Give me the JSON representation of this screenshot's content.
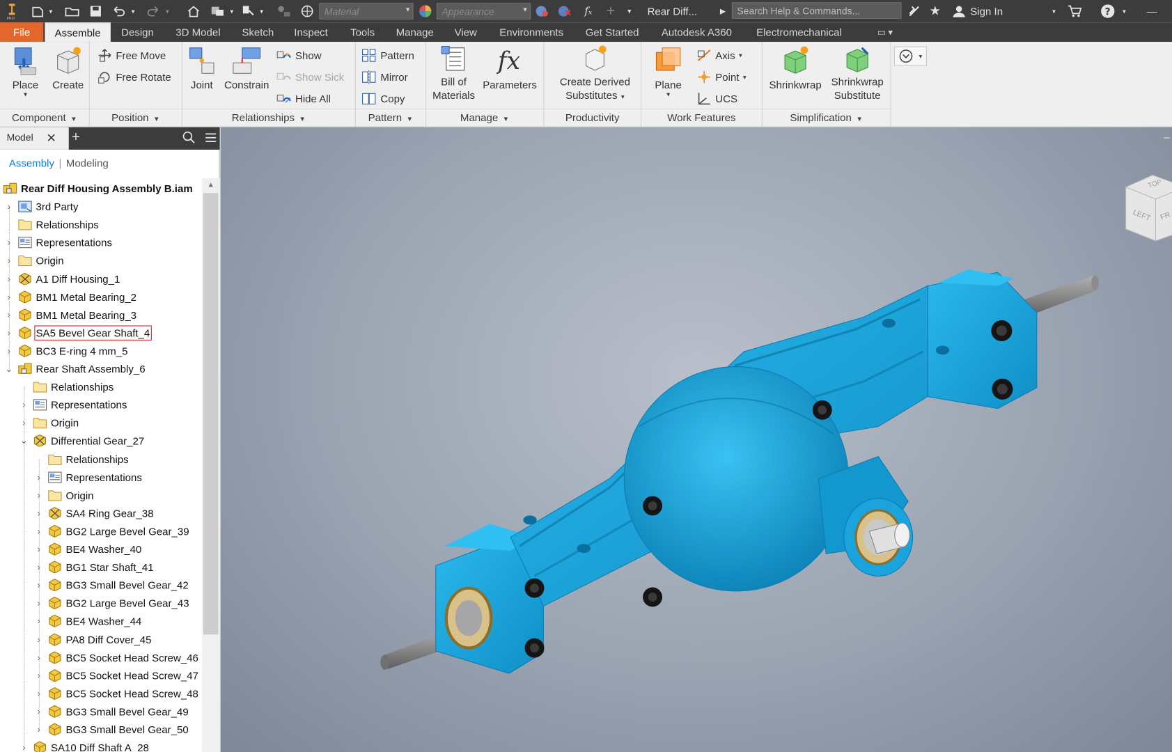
{
  "app": {
    "document_title": "Rear Diff...",
    "search_placeholder": "Search Help & Commands...",
    "sign_in": "Sign In",
    "material_placeholder": "Material",
    "appearance_placeholder": "Appearance"
  },
  "tabs": [
    {
      "label": "File"
    },
    {
      "label": "Assemble"
    },
    {
      "label": "Design"
    },
    {
      "label": "3D Model"
    },
    {
      "label": "Sketch"
    },
    {
      "label": "Inspect"
    },
    {
      "label": "Tools"
    },
    {
      "label": "Manage"
    },
    {
      "label": "View"
    },
    {
      "label": "Environments"
    },
    {
      "label": "Get Started"
    },
    {
      "label": "Autodesk A360"
    },
    {
      "label": "Electromechanical"
    }
  ],
  "ribbon": {
    "component": {
      "title": "Component",
      "place": "Place",
      "create": "Create"
    },
    "position": {
      "title": "Position",
      "free_move": "Free Move",
      "free_rotate": "Free Rotate"
    },
    "relationships": {
      "title": "Relationships",
      "joint": "Joint",
      "constrain": "Constrain",
      "show": "Show",
      "show_sick": "Show Sick",
      "hide_all": "Hide All"
    },
    "pattern": {
      "title": "Pattern",
      "pattern": "Pattern",
      "mirror": "Mirror",
      "copy": "Copy"
    },
    "manage": {
      "title": "Manage",
      "bom_line1": "Bill of",
      "bom_line2": "Materials",
      "parameters": "Parameters"
    },
    "productivity": {
      "title": "Productivity",
      "cds_line1": "Create Derived",
      "cds_line2": "Substitutes"
    },
    "work_features": {
      "title": "Work Features",
      "plane": "Plane",
      "axis": "Axis",
      "point": "Point",
      "ucs": "UCS"
    },
    "simplification": {
      "title": "Simplification",
      "shrinkwrap": "Shrinkwrap",
      "sws_line1": "Shrinkwrap",
      "sws_line2": "Substitute"
    }
  },
  "browser": {
    "tab_label": "Model",
    "subtab_assembly": "Assembly",
    "subtab_modeling": "Modeling",
    "items": [
      {
        "label": "Rear Diff Housing Assembly B.iam",
        "level": 0,
        "icon": "assembly-icon",
        "exp": ""
      },
      {
        "label": "3rd Party",
        "level": 0,
        "icon": "third-party-icon",
        "exp": ">"
      },
      {
        "label": "Relationships",
        "level": 0,
        "icon": "folder-icon",
        "exp": ""
      },
      {
        "label": "Representations",
        "level": 0,
        "icon": "representations-icon",
        "exp": ">"
      },
      {
        "label": "Origin",
        "level": 0,
        "icon": "folder-icon",
        "exp": ">"
      },
      {
        "label": "A1 Diff Housing_1",
        "level": 0,
        "icon": "adaptive-part-icon",
        "exp": ">"
      },
      {
        "label": "BM1 Metal Bearing_2",
        "level": 0,
        "icon": "part-icon",
        "exp": ">"
      },
      {
        "label": "BM1 Metal Bearing_3",
        "level": 0,
        "icon": "part-icon",
        "exp": ">"
      },
      {
        "label": "SA5 Bevel Gear Shaft_4",
        "level": 0,
        "icon": "part-icon",
        "exp": ">",
        "highlight": true
      },
      {
        "label": "BC3 E-ring 4 mm_5",
        "level": 0,
        "icon": "part-icon",
        "exp": ">"
      },
      {
        "label": "Rear Shaft Assembly_6",
        "level": 0,
        "icon": "subassembly-icon",
        "exp": "v"
      },
      {
        "label": "Relationships",
        "level": 1,
        "icon": "folder-icon",
        "exp": ""
      },
      {
        "label": "Representations",
        "level": 1,
        "icon": "representations-icon",
        "exp": ">"
      },
      {
        "label": "Origin",
        "level": 1,
        "icon": "folder-icon",
        "exp": ">"
      },
      {
        "label": "Differential Gear_27",
        "level": 1,
        "icon": "adaptive-part-icon",
        "exp": "v"
      },
      {
        "label": "Relationships",
        "level": 2,
        "icon": "folder-icon",
        "exp": ""
      },
      {
        "label": "Representations",
        "level": 2,
        "icon": "representations-icon",
        "exp": ">"
      },
      {
        "label": "Origin",
        "level": 2,
        "icon": "folder-icon",
        "exp": ">"
      },
      {
        "label": "SA4 Ring Gear_38",
        "level": 2,
        "icon": "adaptive-part-icon",
        "exp": ">"
      },
      {
        "label": "BG2 Large Bevel Gear_39",
        "level": 2,
        "icon": "part-icon",
        "exp": ">"
      },
      {
        "label": "BE4 Washer_40",
        "level": 2,
        "icon": "part-icon",
        "exp": ">"
      },
      {
        "label": "BG1 Star Shaft_41",
        "level": 2,
        "icon": "part-icon",
        "exp": ">"
      },
      {
        "label": "BG3 Small Bevel Gear_42",
        "level": 2,
        "icon": "part-icon",
        "exp": ">"
      },
      {
        "label": "BG2 Large Bevel Gear_43",
        "level": 2,
        "icon": "part-icon",
        "exp": ">"
      },
      {
        "label": "BE4 Washer_44",
        "level": 2,
        "icon": "part-icon",
        "exp": ">"
      },
      {
        "label": "PA8 Diff Cover_45",
        "level": 2,
        "icon": "part-icon",
        "exp": ">"
      },
      {
        "label": "BC5 Socket Head Screw_46",
        "level": 2,
        "icon": "part-icon",
        "exp": ">"
      },
      {
        "label": "BC5 Socket Head Screw_47",
        "level": 2,
        "icon": "part-icon",
        "exp": ">"
      },
      {
        "label": "BC5 Socket Head Screw_48",
        "level": 2,
        "icon": "part-icon",
        "exp": ">"
      },
      {
        "label": "BG3 Small Bevel Gear_49",
        "level": 2,
        "icon": "part-icon",
        "exp": ">"
      },
      {
        "label": "BG3 Small Bevel Gear_50",
        "level": 2,
        "icon": "part-icon",
        "exp": ">"
      },
      {
        "label": "SA10 Diff Shaft A_28",
        "level": 1,
        "icon": "part-icon",
        "exp": ">"
      }
    ]
  },
  "viewcube": {
    "top": "TOP",
    "left": "LEFT",
    "front": "FR"
  },
  "colors": {
    "housing_blue": "#1aa3dc",
    "file_tab": "#e3662b",
    "selection_red": "#d32020",
    "link_blue": "#1478d4"
  }
}
